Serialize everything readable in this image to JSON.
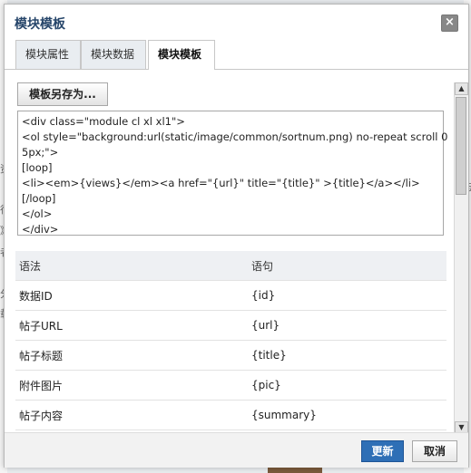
{
  "dialog": {
    "title": "模块模板",
    "close_glyph": "×"
  },
  "tabs": [
    {
      "label": "模块属性"
    },
    {
      "label": "模块数据"
    },
    {
      "label": "模块模板"
    }
  ],
  "saveas_label": "模板另存为...",
  "code_lines": [
    "<div class=\"module cl xl xl1\">",
    "<ol style=\"background:url(static/image/common/sortnum.png) no-repeat scroll 0",
    "5px;\">",
    "[loop]",
    "<li><em>{views}</em><a href=\"{url}\" title=\"{title}\" >{title}</a></li>",
    "[/loop]",
    "</ol>",
    "</div>"
  ],
  "syntax_table": {
    "headers": [
      "语法",
      "语句"
    ],
    "rows": [
      [
        "数据ID",
        "{id}"
      ],
      [
        "帖子URL",
        "{url}"
      ],
      [
        "帖子标题",
        "{title}"
      ],
      [
        "附件图片",
        "{pic}"
      ],
      [
        "帖子内容",
        "{summary}"
      ]
    ]
  },
  "footer": {
    "update_label": "更新",
    "cancel_label": "取消"
  },
  "background_fragments": [
    "资",
    "行",
    "》",
    "者",
    "《",
    "分",
    "载",
    "与"
  ],
  "colors": {
    "title": "#26456a",
    "primary_button": "#2e6fb6"
  }
}
